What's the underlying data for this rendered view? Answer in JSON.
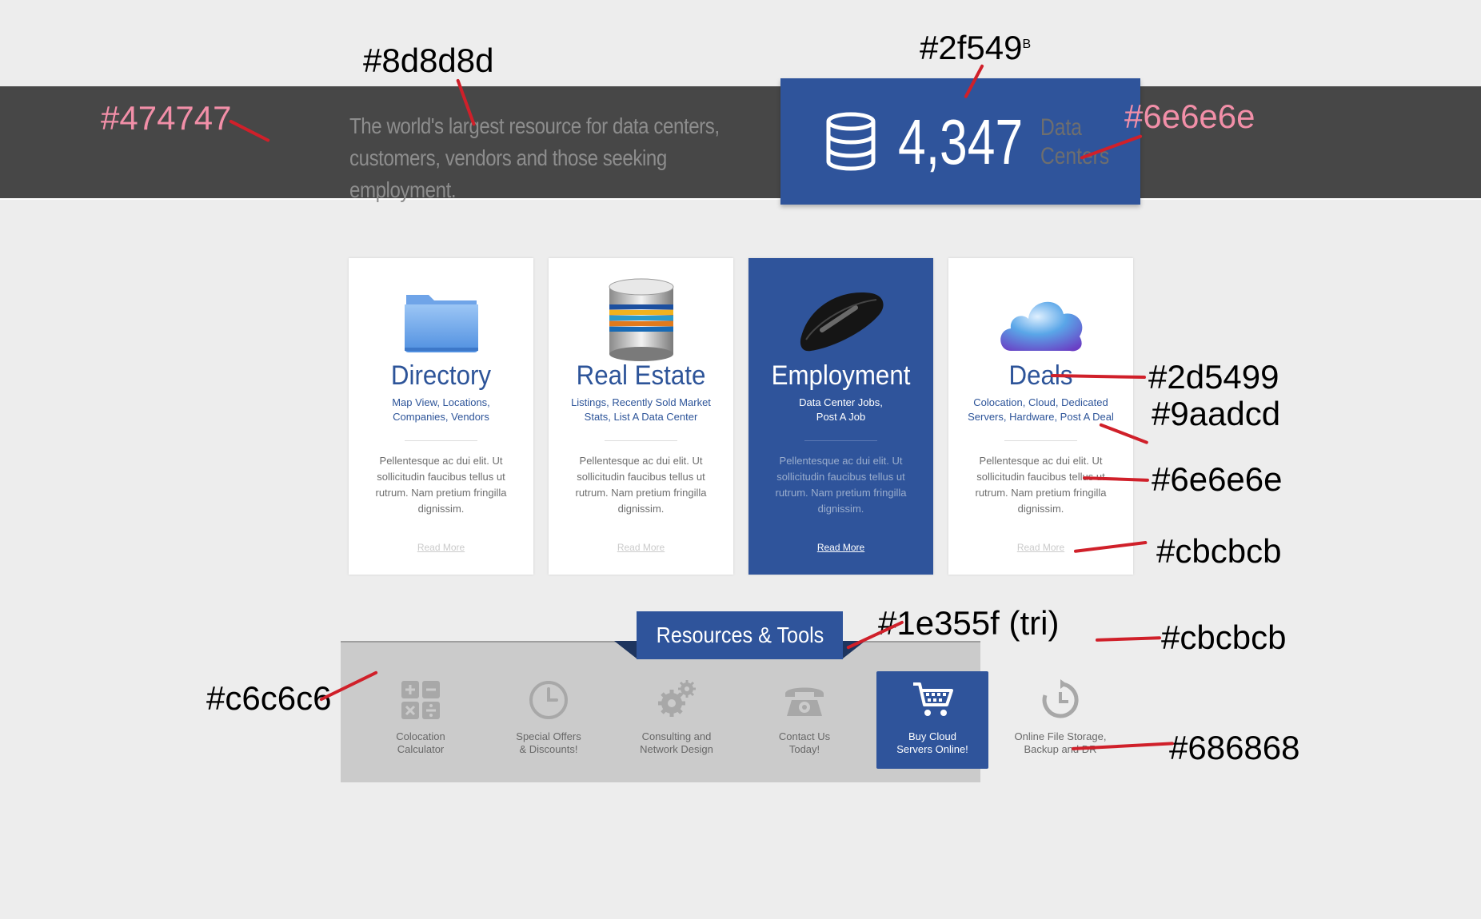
{
  "header": {
    "tagline_line1": "The world's largest resource for data centers,",
    "tagline_line2": "customers, vendors and those seeking employment.",
    "stat_number": "4,347",
    "stat_label_line1": "Data",
    "stat_label_line2": "Centers",
    "stat_icon": "database-icon"
  },
  "cards": [
    {
      "icon": "folder-icon",
      "title": "Directory",
      "sub_line1": "Map View, Locations,",
      "sub_line2": "Companies, Vendors",
      "body": "Pellentesque ac dui elit. Ut sollicitudin faucibus tellus ut rutrum. Nam pretium fringilla dignissim.",
      "link": "Read More"
    },
    {
      "icon": "server-stack-icon",
      "title": "Real Estate",
      "sub_line1": "Listings, Recently Sold Market",
      "sub_line2": "Stats, List A Data Center",
      "body": "Pellentesque ac dui elit. Ut sollicitudin faucibus tellus ut rutrum. Nam pretium fringilla dignissim.",
      "link": "Read More"
    },
    {
      "icon": "mouse-icon",
      "title": "Employment",
      "sub_line1": "Data Center Jobs,",
      "sub_line2": "Post A Job",
      "body": "Pellentesque ac dui elit. Ut sollicitudin faucibus tellus ut rutrum. Nam pretium fringilla dignissim.",
      "link": "Read More"
    },
    {
      "icon": "cloud-icon",
      "title": "Deals",
      "sub_line1": "Colocation, Cloud, Dedicated",
      "sub_line2": "Servers, Hardware, Post A Deal",
      "body": "Pellentesque ac dui elit. Ut sollicitudin faucibus tellus ut rutrum. Nam pretium fringilla dignissim.",
      "link": "Read More"
    }
  ],
  "resources": {
    "title": "Resources & Tools",
    "tools": [
      {
        "icon": "calculator-icon",
        "line1": "Colocation",
        "line2": "Calculator"
      },
      {
        "icon": "clock-icon",
        "line1": "Special Offers",
        "line2": "& Discounts!"
      },
      {
        "icon": "gears-icon",
        "line1": "Consulting and",
        "line2": "Network Design"
      },
      {
        "icon": "phone-icon",
        "line1": "Contact Us",
        "line2": "Today!"
      },
      {
        "icon": "cart-icon",
        "line1": "Buy Cloud",
        "line2": "Servers Online!"
      },
      {
        "icon": "backup-icon",
        "line1": "Online File Storage,",
        "line2": "Backup and DR"
      }
    ]
  },
  "annotations": {
    "a1": "#8d8d8d",
    "a2": "#2f549",
    "a2_sup": "B",
    "a3": "#474747",
    "a4": "#6e6e6e",
    "a5": "#2d5499",
    "a6": "#9aadcd",
    "a7": "#6e6e6e",
    "a8": "#cbcbcb",
    "a9": "#1e355f (tri)",
    "a10": "#cbcbcb",
    "a11": "#c6c6c6",
    "a12": "#686868"
  },
  "colors": {
    "page_bg": "#ededed",
    "band": "#474747",
    "brand_blue": "#2f549b",
    "title_blue": "#2d5499",
    "triangle": "#1e355f",
    "panel": "#cbcbcb",
    "annotation_line": "#d0202a"
  }
}
